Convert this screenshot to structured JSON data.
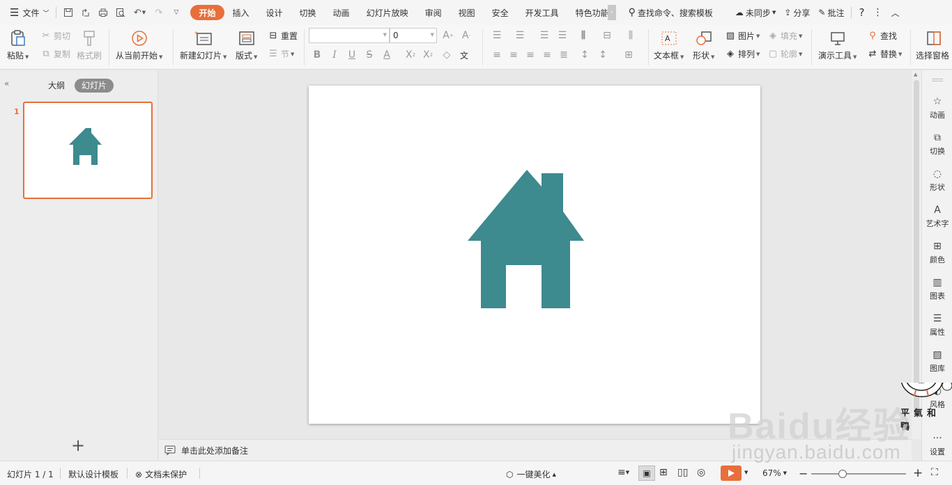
{
  "menubar": {
    "file_label": "文件",
    "tabs": [
      {
        "label": "开始",
        "active": true
      },
      {
        "label": "插入"
      },
      {
        "label": "设计"
      },
      {
        "label": "切换"
      },
      {
        "label": "动画"
      },
      {
        "label": "幻灯片放映"
      },
      {
        "label": "审阅"
      },
      {
        "label": "视图"
      },
      {
        "label": "安全"
      },
      {
        "label": "开发工具"
      },
      {
        "label": "特色功能"
      }
    ],
    "search_placeholder": "查找命令、搜索模板",
    "sync_label": "未同步",
    "share_label": "分享",
    "comment_label": "批注"
  },
  "ribbon": {
    "paste": "粘贴",
    "cut": "剪切",
    "copy": "复制",
    "format_painter": "格式刷",
    "play_from_current": "从当前开始",
    "new_slide": "新建幻灯片",
    "layout": "版式",
    "reset": "重置",
    "section": "节",
    "font_name": "",
    "font_size": "0",
    "text_box": "文本框",
    "shape": "形状",
    "picture": "图片",
    "fill": "填充",
    "arrange": "排列",
    "outline": "轮廓",
    "presentation_tools": "演示工具",
    "find": "查找",
    "replace": "替换",
    "select_pane": "选择窗格"
  },
  "leftpane": {
    "outline_tab": "大纲",
    "slides_tab": "幻灯片",
    "slide_number": "1",
    "add_slide": "+"
  },
  "notes": {
    "placeholder": "单击此处添加备注"
  },
  "rightbar": {
    "items": [
      "动画",
      "切换",
      "形状",
      "艺术字",
      "颜色",
      "图表",
      "属性",
      "图库",
      "风格",
      "设置"
    ]
  },
  "statusbar": {
    "slide_info": "幻灯片 1 / 1",
    "template": "默认设计模板",
    "protection": "文档未保护",
    "beautify": "一键美化",
    "zoom": "67%",
    "zoom_fraction": 0.33
  },
  "watermark": {
    "brand": "Baidu经验",
    "url": "jingyan.baidu.com",
    "sticker_text": "平氣和鴨"
  },
  "colors": {
    "accent": "#e86f3b",
    "house": "#3d8a8f"
  }
}
